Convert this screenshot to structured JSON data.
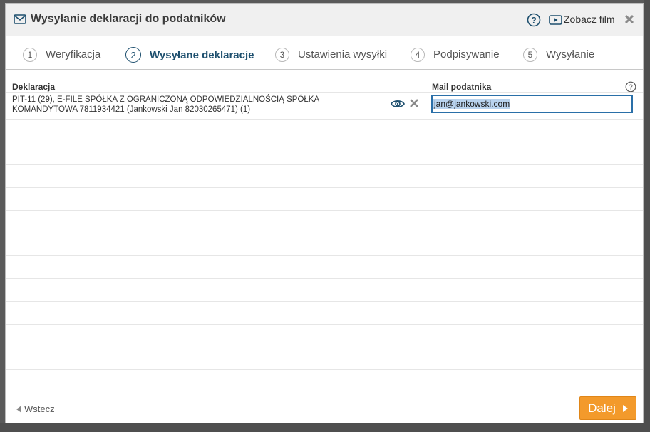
{
  "dialog": {
    "title": "Wysyłanie deklaracji do podatników",
    "video_label": "Zobacz film"
  },
  "tabs": [
    {
      "num": "1",
      "label": "Weryfikacja"
    },
    {
      "num": "2",
      "label": "Wysyłane deklaracje"
    },
    {
      "num": "3",
      "label": "Ustawienia wysyłki"
    },
    {
      "num": "4",
      "label": "Podpisywanie"
    },
    {
      "num": "5",
      "label": "Wysyłanie"
    }
  ],
  "active_tab": 1,
  "table": {
    "col_declaration": "Deklaracja",
    "col_mail": "Mail podatnika",
    "rows": [
      {
        "declaration": "PIT-11 (29), E-FILE SPÓŁKA Z OGRANICZONĄ ODPOWIEDZIALNOŚCIĄ SPÓŁKA KOMANDYTOWA 7811934421 (Jankowski Jan 82030265471) (1)",
        "mail": "jan@jankowski.com"
      }
    ]
  },
  "footer": {
    "back_label": "Wstecz",
    "next_label": "Dalej"
  },
  "colors": {
    "accent": "#1d4f6e",
    "next_button": "#f39a2b",
    "input_border": "#2a6fa8"
  }
}
